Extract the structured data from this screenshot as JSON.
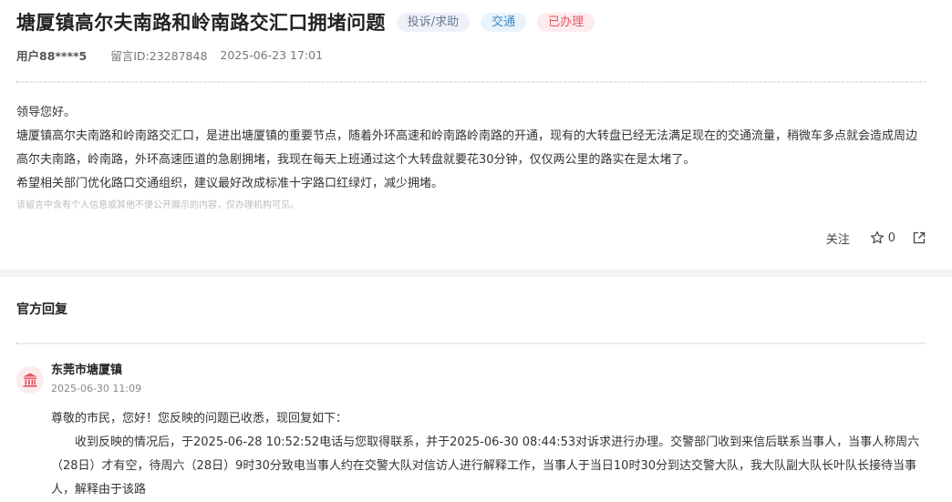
{
  "header": {
    "title": "塘厦镇高尔夫南路和岭南路交汇口拥堵问题",
    "tags": {
      "category": "投诉/求助",
      "topic": "交通",
      "status": "已办理"
    },
    "meta": {
      "user": "用户88****5",
      "message_id": "留言ID:23287848",
      "datetime": "2025-06-23 17:01"
    }
  },
  "message": {
    "paragraphs": [
      "领导您好。",
      "塘厦镇高尔夫南路和岭南路交汇口，是进出塘厦镇的重要节点，随着外环高速和岭南路岭南路的开通，现有的大转盘已经无法满足现在的交通流量，稍微车多点就会造成周边高尔夫南路，岭南路，外环高速匝道的急剧拥堵，我现在每天上班通过这个大转盘就要花30分钟，仅仅两公里的路实在是太堵了。",
      "希望相关部门优化路口交通组织，建议最好改成标准十字路口红绿灯，减少拥堵。"
    ],
    "privacy_notice": "该留言中含有个人信息或其他不便公开展示的内容，仅办理机构可见。"
  },
  "actions": {
    "follow_label": "关注",
    "star_count": "0"
  },
  "official_reply": {
    "heading": "官方回复",
    "org_name": "东莞市塘厦镇",
    "org_datetime": "2025-06-30 11:09",
    "greeting": "尊敬的市民，您好！您反映的问题已收悉，现回复如下：",
    "body": "收到反映的情况后，于2025-06-28 10:52:52电话与您取得联系，并于2025-06-30 08:44:53对诉求进行办理。交警部门收到来信后联系当事人，当事人称周六（28日）才有空，待周六（28日）9时30分致电当事人约在交警大队对信访人进行解释工作，当事人于当日10时30分到达交警大队，我大队副大队长叶队长接待当事人，解释由于该路"
  },
  "colors": {
    "status_red": "#e25563",
    "topic_blue": "#3a89c9"
  }
}
